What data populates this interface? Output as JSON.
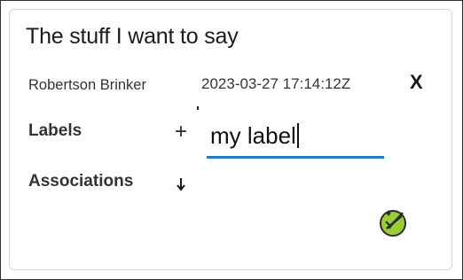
{
  "note": {
    "title": "The stuff I want to say",
    "author": "Robertson Brinker",
    "timestamp": "2023-03-27 17:14:12Z",
    "close_label": "X"
  },
  "labels": {
    "heading": "Labels",
    "add_symbol": "+",
    "input_value": "my label"
  },
  "associations": {
    "heading": "Associations",
    "arrow_icon": "arrow-down-icon"
  },
  "badge": {
    "icon": "leaf-check-icon"
  },
  "colors": {
    "input_underline": "#1e7bd8",
    "badge_fill": "#9acd32",
    "badge_outline": "#2b2b2b"
  }
}
